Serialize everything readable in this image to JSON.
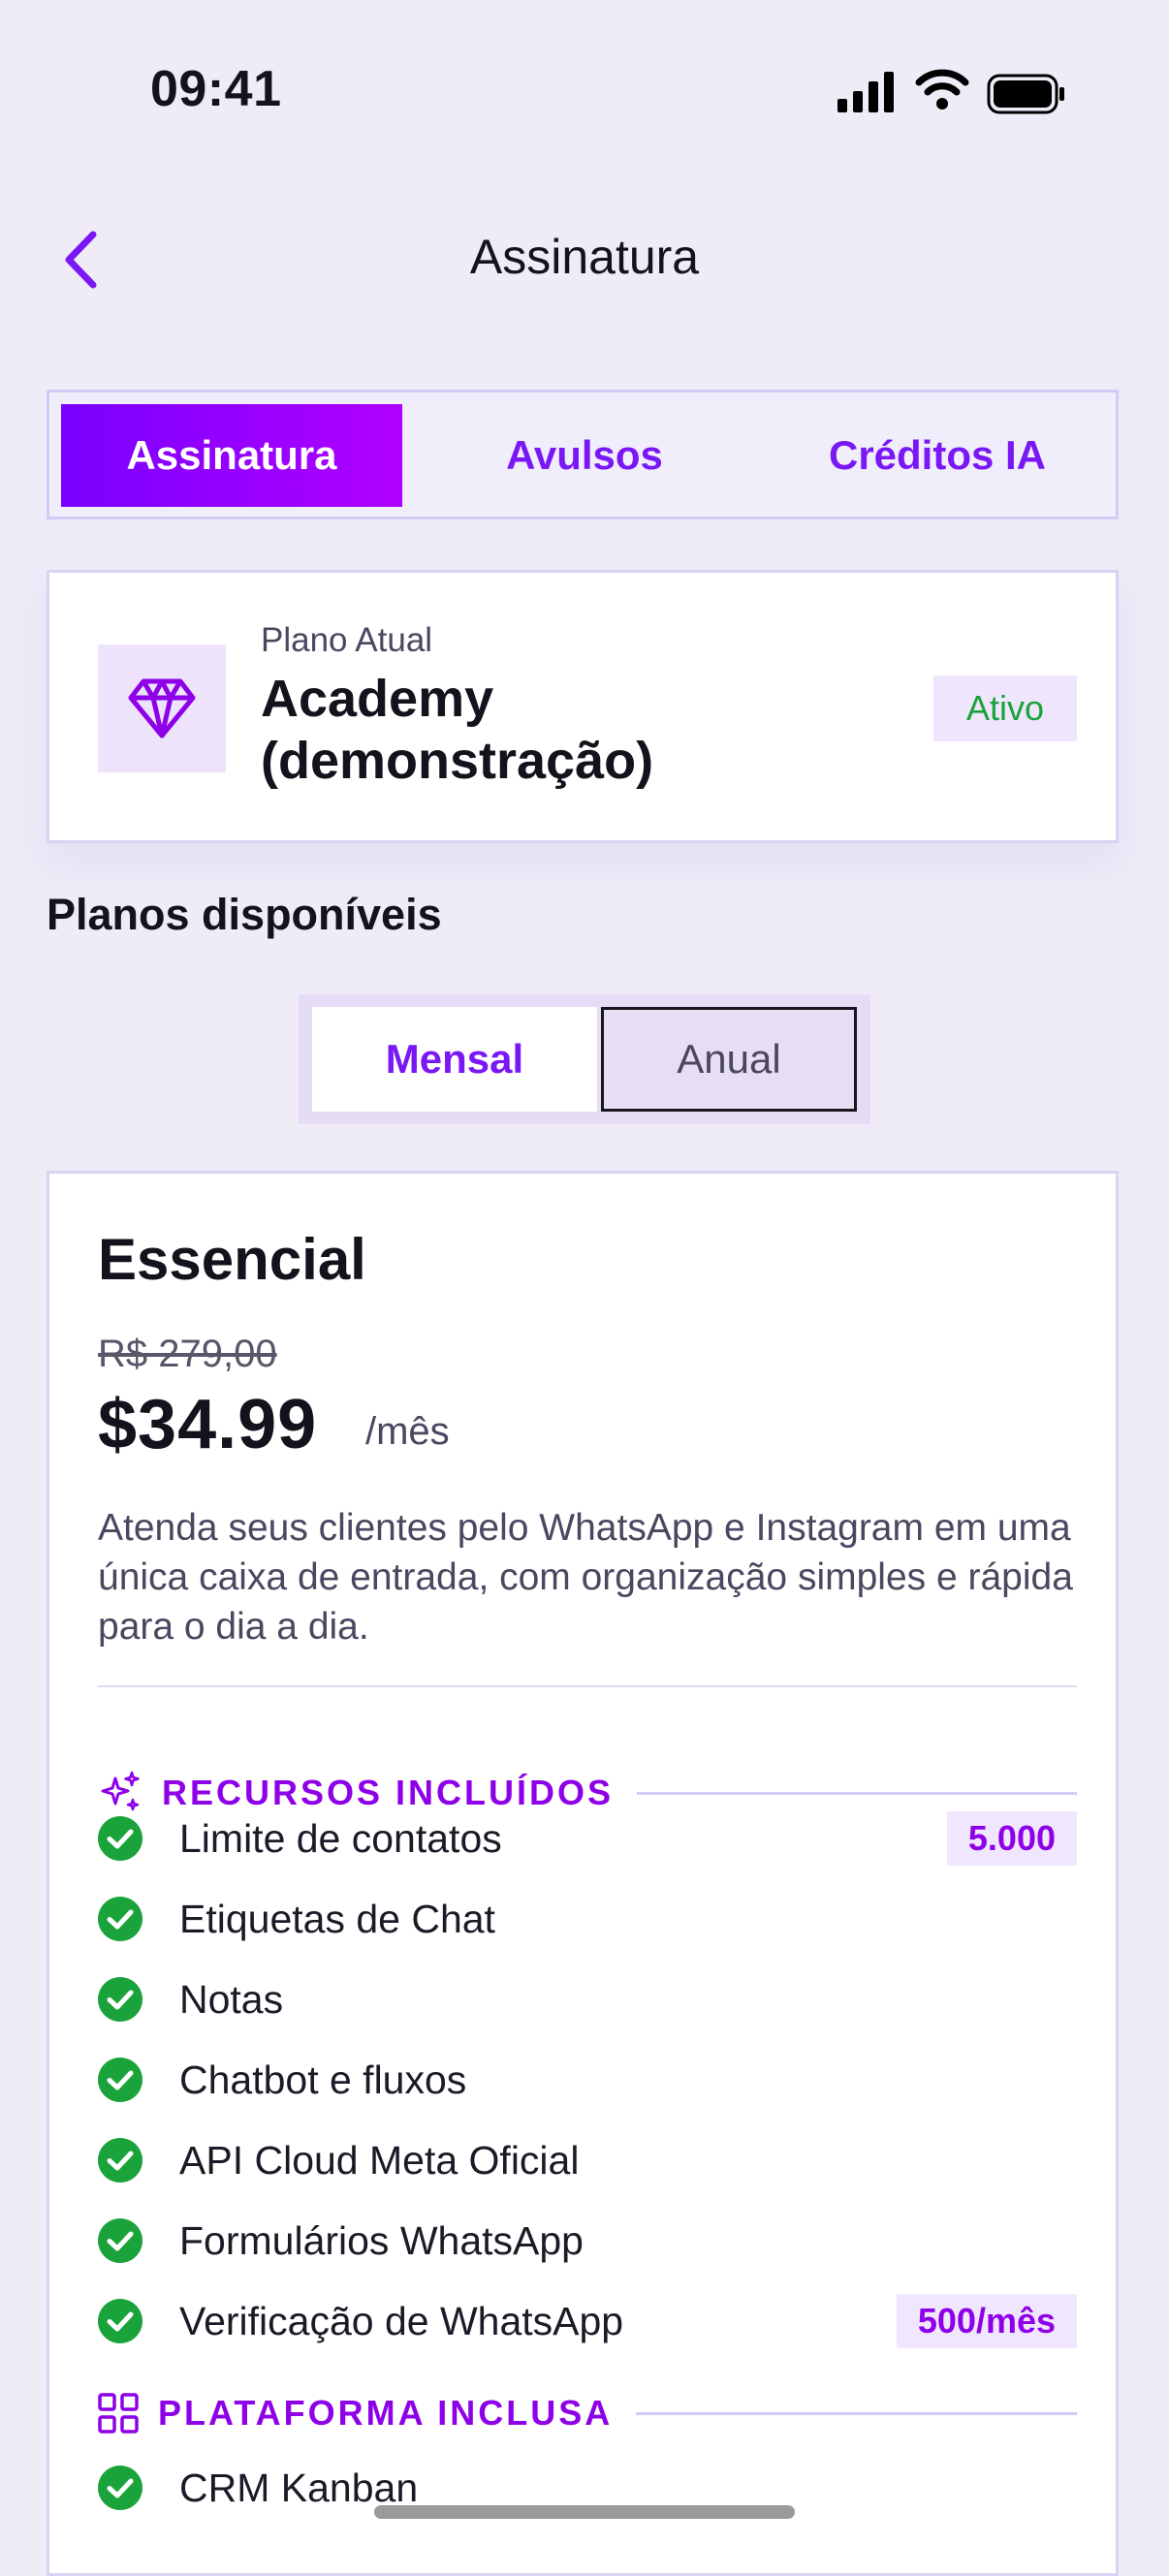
{
  "status_bar": {
    "time": "09:41"
  },
  "header": {
    "title": "Assinatura"
  },
  "tabs": [
    {
      "label": "Assinatura",
      "active": true
    },
    {
      "label": "Avulsos",
      "active": false
    },
    {
      "label": "Créditos IA",
      "active": false
    }
  ],
  "current_plan": {
    "label": "Plano Atual",
    "name_line1": "Academy",
    "name_line2": "(demonstração)",
    "status": "Ativo",
    "icon": "diamond-icon"
  },
  "available_plans": {
    "title": "Planos disponíveis"
  },
  "billing_toggle": {
    "monthly": "Mensal",
    "annual": "Anual",
    "selected": "Mensal"
  },
  "offer": {
    "name": "Essencial",
    "old_price": "R$ 279,00",
    "price": "$34.99",
    "period": "/mês",
    "description": "Atenda seus clientes pelo WhatsApp e Instagram em uma única caixa de entrada, com organização simples e rápida para o dia a dia.",
    "resources_title": "RECURSOS INCLUÍDOS",
    "features": [
      {
        "label": "Limite de contatos",
        "badge": "5.000"
      },
      {
        "label": "Etiquetas de Chat"
      },
      {
        "label": "Notas"
      },
      {
        "label": "Chatbot e fluxos"
      },
      {
        "label": "API Cloud Meta Oficial"
      },
      {
        "label": "Formulários WhatsApp"
      },
      {
        "label": "Verificação de WhatsApp",
        "badge": "500/mês"
      }
    ],
    "platform_title": "PLATAFORMA INCLUSA",
    "platform_features": [
      {
        "label": "CRM Kanban"
      }
    ]
  },
  "colors": {
    "accent": "#7A17F5",
    "accent_gradient_end": "#B000FF",
    "check_green": "#19A33A",
    "background": "#EFECF8"
  }
}
